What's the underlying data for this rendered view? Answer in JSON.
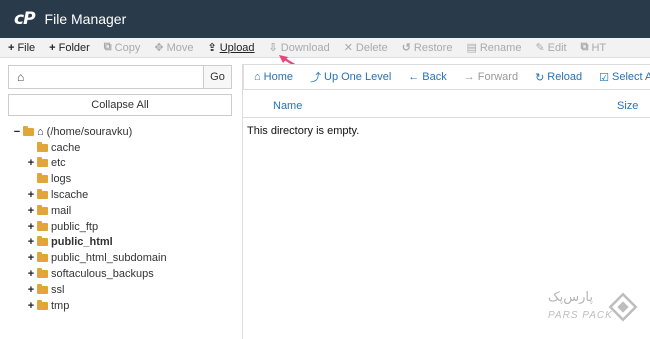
{
  "titlebar": {
    "logo": "cP",
    "title": "File Manager"
  },
  "toolbar": {
    "items": [
      {
        "icon": "+",
        "label": "File",
        "enabled": true
      },
      {
        "icon": "+",
        "label": "Folder",
        "enabled": true
      },
      {
        "icon": "⧉",
        "label": "Copy",
        "enabled": false
      },
      {
        "icon": "✥",
        "label": "Move",
        "enabled": false
      },
      {
        "icon": "⇪",
        "label": "Upload",
        "enabled": true
      },
      {
        "icon": "⇩",
        "label": "Download",
        "enabled": false
      },
      {
        "icon": "✕",
        "label": "Delete",
        "enabled": false
      },
      {
        "icon": "↺",
        "label": "Restore",
        "enabled": false
      },
      {
        "icon": "▤",
        "label": "Rename",
        "enabled": false
      },
      {
        "icon": "✎",
        "label": "Edit",
        "enabled": false
      },
      {
        "icon": "⧉",
        "label": "HT",
        "enabled": false
      }
    ]
  },
  "left": {
    "path_icon": "⌂",
    "path_value": "",
    "go_label": "Go",
    "collapse_label": "Collapse All",
    "tree": {
      "root_label": "(/home/souravku)",
      "children": [
        {
          "label": "cache",
          "expandable": false,
          "bold": false
        },
        {
          "label": "etc",
          "expandable": true,
          "bold": false
        },
        {
          "label": "logs",
          "expandable": false,
          "bold": false
        },
        {
          "label": "lscache",
          "expandable": true,
          "bold": false
        },
        {
          "label": "mail",
          "expandable": true,
          "bold": false
        },
        {
          "label": "public_ftp",
          "expandable": true,
          "bold": false
        },
        {
          "label": "public_html",
          "expandable": true,
          "bold": true
        },
        {
          "label": "public_html_subdomain",
          "expandable": true,
          "bold": false
        },
        {
          "label": "softaculous_backups",
          "expandable": true,
          "bold": false
        },
        {
          "label": "ssl",
          "expandable": true,
          "bold": false
        },
        {
          "label": "tmp",
          "expandable": true,
          "bold": false
        }
      ]
    }
  },
  "nav": {
    "home": "Home",
    "up": "Up One Level",
    "back": "Back",
    "forward": "Forward",
    "reload": "Reload",
    "select_all": "Select All"
  },
  "table": {
    "col_name": "Name",
    "col_size": "Size",
    "empty_message": "This directory is empty."
  },
  "watermark": {
    "line1": "پارس‌پک",
    "line2": "PARS PACK"
  },
  "colors": {
    "titlebar": "#293a4a",
    "link": "#2573b7",
    "folder": "#e0a63a",
    "arrow": "#e8457a"
  }
}
